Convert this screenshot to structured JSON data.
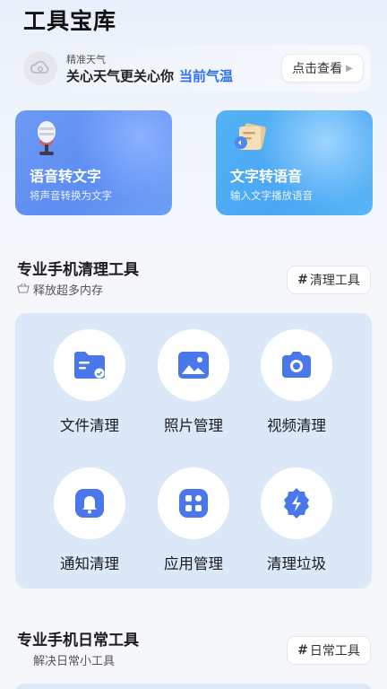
{
  "app": {
    "title": "工具宝库"
  },
  "weather": {
    "small_label": "精准天气",
    "main_text": "关心天气更关心你",
    "highlight_text": "当前气温",
    "button_label": "点击查看"
  },
  "features": [
    {
      "title": "语音转文字",
      "subtitle": "将声音转换为文字",
      "icon": "microphone-icon"
    },
    {
      "title": "文字转语音",
      "subtitle": "输入文字播放语音",
      "icon": "document-audio-icon"
    }
  ],
  "cleanup_section": {
    "title": "专业手机清理工具",
    "subtitle": "释放超多内存",
    "tag_label": "清理工具",
    "tools": [
      {
        "label": "文件清理",
        "icon": "folder-icon"
      },
      {
        "label": "照片管理",
        "icon": "photo-icon"
      },
      {
        "label": "视频清理",
        "icon": "camera-icon"
      },
      {
        "label": "通知清理",
        "icon": "bell-icon"
      },
      {
        "label": "应用管理",
        "icon": "apps-icon"
      },
      {
        "label": "清理垃圾",
        "icon": "lightning-icon"
      }
    ]
  },
  "daily_section": {
    "title": "专业手机日常工具",
    "subtitle": "解决日常小工具",
    "tag_label": "日常工具"
  },
  "colors": {
    "accent": "#2d6ff2",
    "icon_blue": "#4a78ea",
    "panel_bg": "#dbe8f8"
  }
}
